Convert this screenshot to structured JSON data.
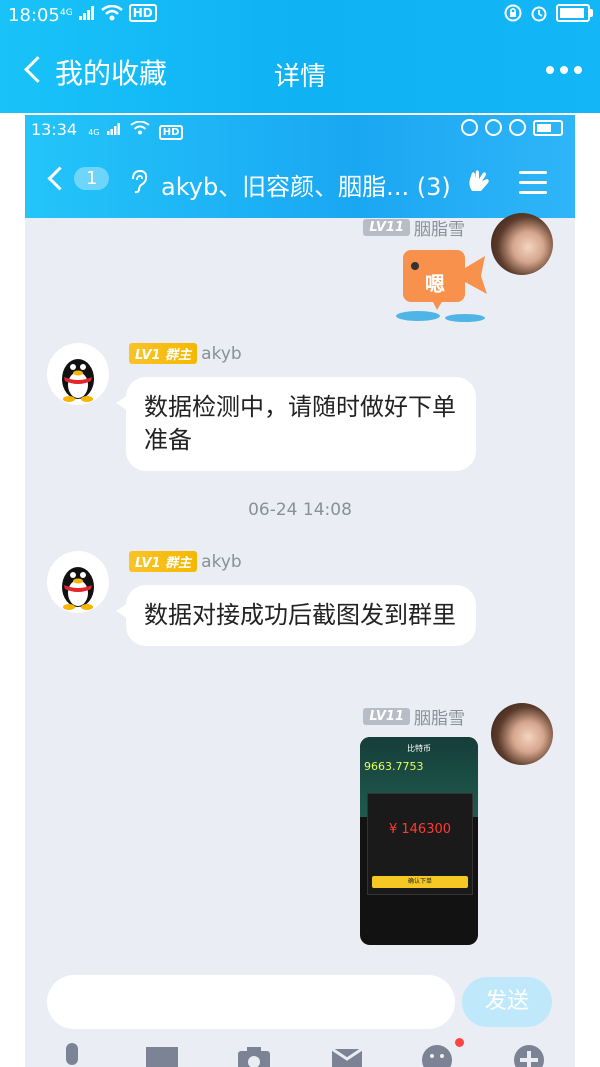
{
  "outer": {
    "status_time": "18:05",
    "signal_label": "4G",
    "hd_label": "HD",
    "back_label": "我的收藏",
    "title": "详情"
  },
  "chat": {
    "status_time": "13:34",
    "signal_label": "4G",
    "hd_label": "HD",
    "unread_count": "1",
    "title": "akyb、旧容颜、胭脂...",
    "member_count": "(3)",
    "messages": [
      {
        "sender": "胭脂雪",
        "level": "LV11",
        "type": "sticker",
        "sticker_text": "嗯"
      },
      {
        "sender": "akyb",
        "level": "LV1",
        "role": "群主",
        "text": "数据检测中，请随时做好下单准备"
      },
      {
        "sender": "akyb",
        "level": "LV1",
        "role": "群主",
        "text": "数据对接成功后截图发到群里"
      },
      {
        "sender": "胭脂雪",
        "level": "LV11",
        "type": "image",
        "image_title": "比特币",
        "image_price": "9663.7753",
        "image_amount": "¥ 146300",
        "image_button": "确认下单"
      }
    ],
    "timestamp": "06-24 14:08",
    "send_label": "发送"
  }
}
